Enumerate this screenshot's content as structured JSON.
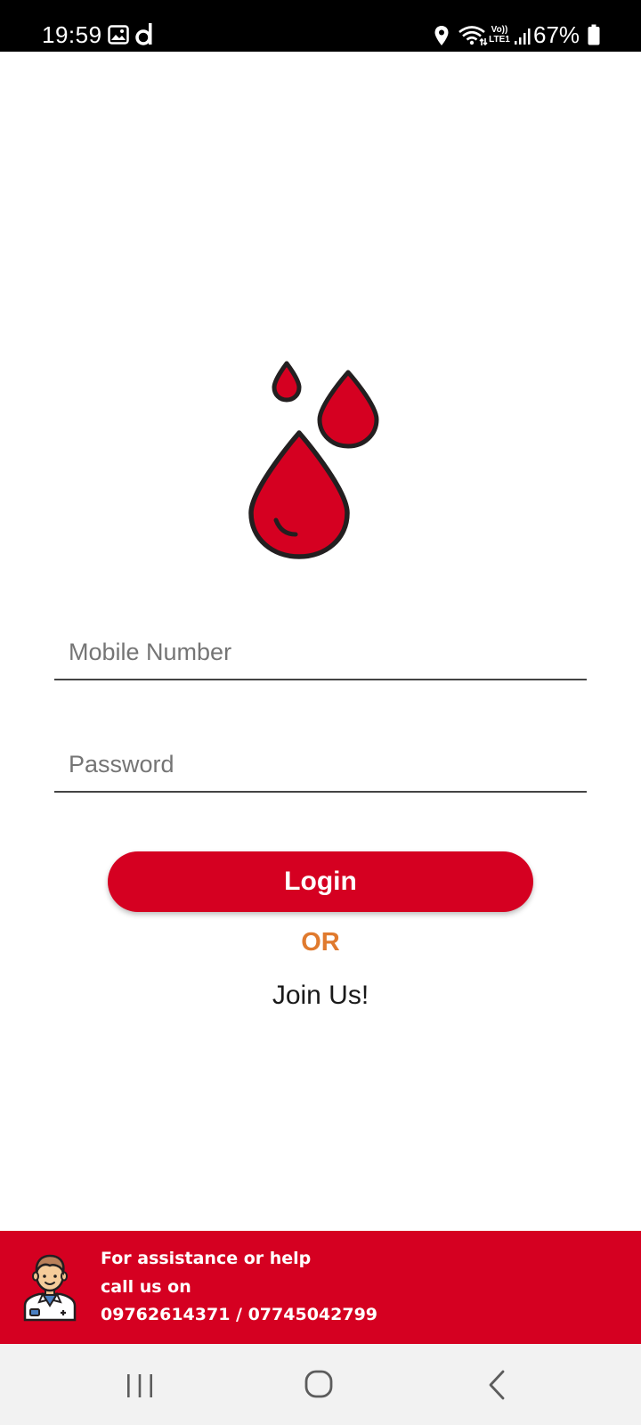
{
  "status_bar": {
    "time": "19:59",
    "battery_percent": "67%",
    "network_label": "Vo)) LTE1",
    "icons": [
      "gallery-icon",
      "app-notification-icon",
      "location-icon",
      "wifi-icon",
      "signal-icon",
      "battery-icon"
    ]
  },
  "logo": {
    "icon": "blood-drops-icon",
    "colors": {
      "fill": "#d50021",
      "stroke": "#231f20"
    }
  },
  "form": {
    "mobile_placeholder": "Mobile Number",
    "password_placeholder": "Password",
    "login_label": "Login",
    "or_label": "OR",
    "join_label": "Join Us!"
  },
  "help_banner": {
    "icon": "doctor-avatar",
    "line1": "For assistance or help",
    "line2": "call us on",
    "line3": "09762614371 / 07745042799"
  },
  "nav_bar": {
    "icons": [
      "recent-apps-icon",
      "home-icon",
      "back-icon"
    ]
  },
  "theme": {
    "accent": "#d50021",
    "or_color": "#e07a2e",
    "status_bar_bg": "#000000",
    "nav_bar_bg": "#f2f2f2"
  }
}
